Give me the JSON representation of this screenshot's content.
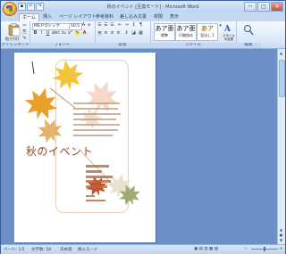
{
  "window": {
    "title": "秋のイベント [互換モード] - Microsoft Word",
    "min": "─",
    "max": "□",
    "close": "✕"
  },
  "tabs": [
    "ホーム",
    "挿入",
    "ページ レイアウト",
    "参考資料",
    "差し込み文書",
    "校閲",
    "表示"
  ],
  "ribbon": {
    "clipboard": {
      "paste": "貼り付け",
      "label": "クリップボード"
    },
    "font": {
      "name": "MS Pゴシック",
      "size": "10.5",
      "label": "フォント"
    },
    "paragraph": {
      "label": "段落"
    },
    "styles": {
      "items": [
        {
          "preview": "あア亜",
          "name": "標準"
        },
        {
          "preview": "あア亜",
          "name": "行間詰め"
        },
        {
          "preview": "あア",
          "name": "見出し 1"
        }
      ],
      "change": "スタイルの変更",
      "label": "スタイル"
    },
    "editing": {
      "label": "編集"
    }
  },
  "document": {
    "title": "秋のイベント"
  },
  "status": {
    "page": "ページ: 1/1",
    "words": "文字数: 58",
    "lang": "日本語",
    "mode": "挿入モード"
  },
  "colors": {
    "leaf_orange": "#e89a1e",
    "leaf_yellow": "#f2c12e",
    "leaf_red": "#c8452a",
    "leaf_pink": "#f3c9b8",
    "leaf_green": "#9ca56a",
    "title_brown": "#8a4a22"
  }
}
